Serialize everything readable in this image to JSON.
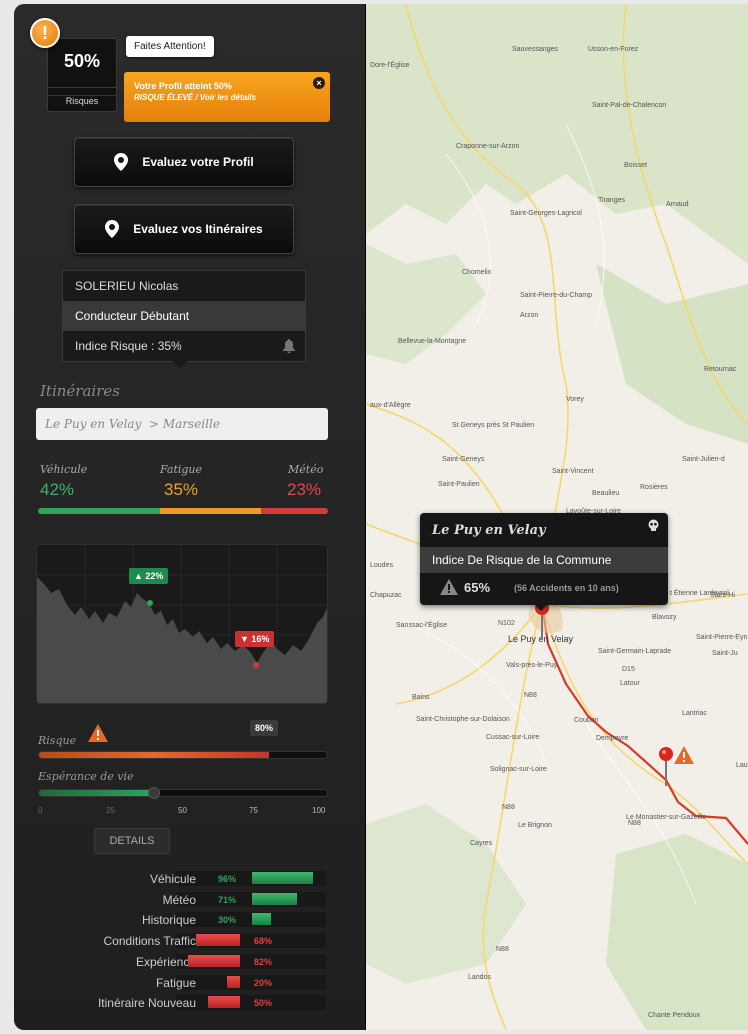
{
  "alert": {
    "icon": "exclamation-icon",
    "badge_text": "!",
    "risk_percent": "50%",
    "risk_label": "Risques",
    "bubble": "Faites Attention!",
    "note_line1": "Votre Profil atteint 50%",
    "note_line2": "RISQUE ÉLEVÉ / Voir les détails",
    "close": "×"
  },
  "buttons": {
    "profile": "Evaluez votre Profil",
    "itineraries": "Evaluez vos Itinéraires"
  },
  "profile": {
    "name": "SOLERIEU Nicolas",
    "level": "Conducteur Débutant",
    "risk_index": "Indice Risque : 35%"
  },
  "itineraries": {
    "title": "Itinéraires",
    "route_value": "Le Puy en Velay  > Marseille"
  },
  "stats": [
    {
      "label": "Véhicule",
      "value": "42%",
      "color": "#2fa35a",
      "fraction": 0.42
    },
    {
      "label": "Fatigue",
      "value": "35%",
      "color": "#ee9a28",
      "fraction": 0.35
    },
    {
      "label": "Météo",
      "value": "23%",
      "color": "#d23b3b",
      "fraction": 0.23
    }
  ],
  "trend": {
    "up_tag": "▲ 22%",
    "down_tag": "▼ 16%"
  },
  "sliders": {
    "risk_label": "Risque",
    "risk_value": "80%",
    "risk_fraction": 0.8,
    "life_label": "Espérance de vie",
    "life_fraction": 0.4,
    "ticks": [
      "0",
      "25",
      "50",
      "75",
      "100"
    ]
  },
  "details": {
    "button": "DETAILS",
    "rows": [
      {
        "name": "Véhicule",
        "value": "96%",
        "fraction": 0.96,
        "positive": true
      },
      {
        "name": "Météo",
        "value": "71%",
        "fraction": 0.71,
        "positive": true
      },
      {
        "name": "Historique",
        "value": "30%",
        "fraction": 0.3,
        "positive": true
      },
      {
        "name": "Conditions Traffic",
        "value": "68%",
        "fraction": 0.68,
        "positive": false
      },
      {
        "name": "Expérience",
        "value": "82%",
        "fraction": 0.82,
        "positive": false
      },
      {
        "name": "Fatigue",
        "value": "20%",
        "fraction": 0.2,
        "positive": false
      },
      {
        "name": "Itinéraire Nouveau",
        "value": "50%",
        "fraction": 0.5,
        "positive": false
      }
    ]
  },
  "map": {
    "callout_title": "Le Puy en Velay",
    "callout_subtitle": "Indice De Risque de la Commune",
    "callout_percent": "65%",
    "callout_accidents": "(56 Accidents en 10 ans)",
    "towns": [
      "Sauvessanges",
      "Usson-en-Forez",
      "Dore-l'Église",
      "Saint-Pal-de-Chalencon",
      "Craponne-sur-Arzon",
      "Boisset",
      "Tiranges",
      "Arnaud",
      "Saint-Georges-Lagricol",
      "Chomelix",
      "Saint-Pierre-du-Champ",
      "Arzon",
      "Bellevue-la-Montagne",
      "Retournac",
      "aux-d'Allègre",
      "Vorey",
      "St Geneys près St Paulien",
      "Saint-Geneys",
      "Saint-Vincent",
      "Saint-Julien-d",
      "Saint-Paulien",
      "Beaulieu",
      "Rosières",
      "Lavoûte-sur-Loire",
      "Loudes",
      "Chapuzac",
      "Sanssac-l'Église",
      "t Étienne Lardeyrol",
      "Saint-Hi",
      "Blavozy",
      "Saint-Pierre-Eyn",
      "Saint-Germain-Laprade",
      "Saint-Ju",
      "Le Puy en Velay",
      "Vals-près-le-Puy",
      "Latour",
      "Bains",
      "Saint-Christophe-sur-Dolaison",
      "Lantriac",
      "Cussac-sur-Loire",
      "Coubon",
      "Dempeyre",
      "Solignac-sur-Loire",
      "Laur",
      "Le Monastier-sur-Gazeille",
      "Le Brignon",
      "Cayres",
      "Landos",
      "Chante Pendoux",
      "N102",
      "N88",
      "N88",
      "N88",
      "N88",
      "D15"
    ]
  }
}
